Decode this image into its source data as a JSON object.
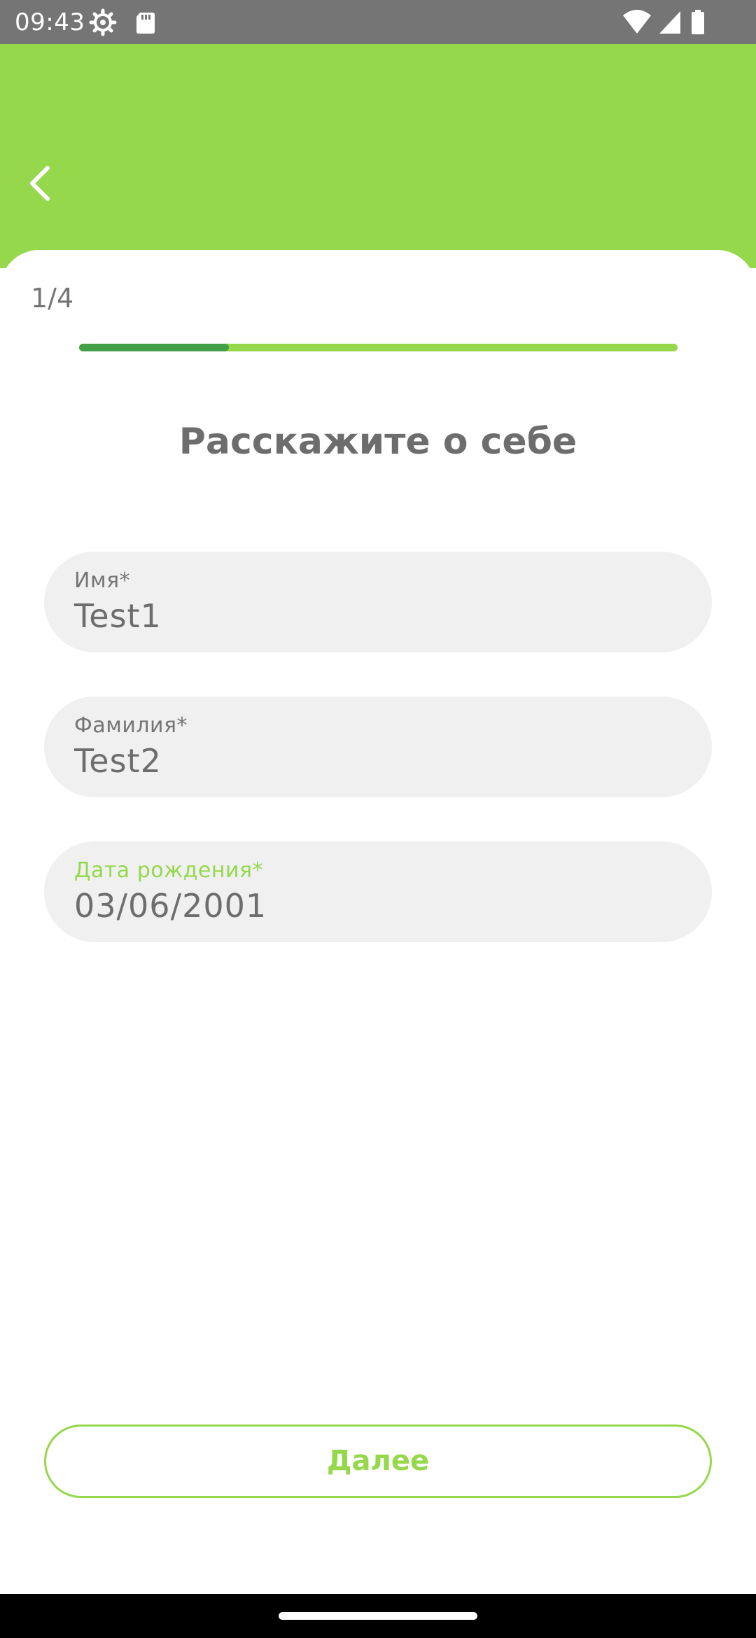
{
  "status_bar": {
    "time": "09:43",
    "icons": [
      "settings-icon",
      "sd-card-icon",
      "wifi-icon",
      "signal-icon",
      "battery-icon"
    ]
  },
  "header": {
    "background_color": "#95d84b",
    "back_icon": "chevron-left-icon"
  },
  "progress": {
    "step_label": "1/4",
    "value_fraction": 0.25,
    "fill_color": "#43a047",
    "track_color": "#95d84b"
  },
  "form": {
    "title": "Расскажите о себе",
    "fields": [
      {
        "label": "Имя*",
        "value": "Test1",
        "focused": false
      },
      {
        "label": "Фамилия*",
        "value": "Test2",
        "focused": false
      },
      {
        "label": "Дата рождения*",
        "value": "03/06/2001",
        "focused": true
      }
    ],
    "accent_color": "#95d84b"
  },
  "actions": {
    "next_label": "Далее"
  }
}
